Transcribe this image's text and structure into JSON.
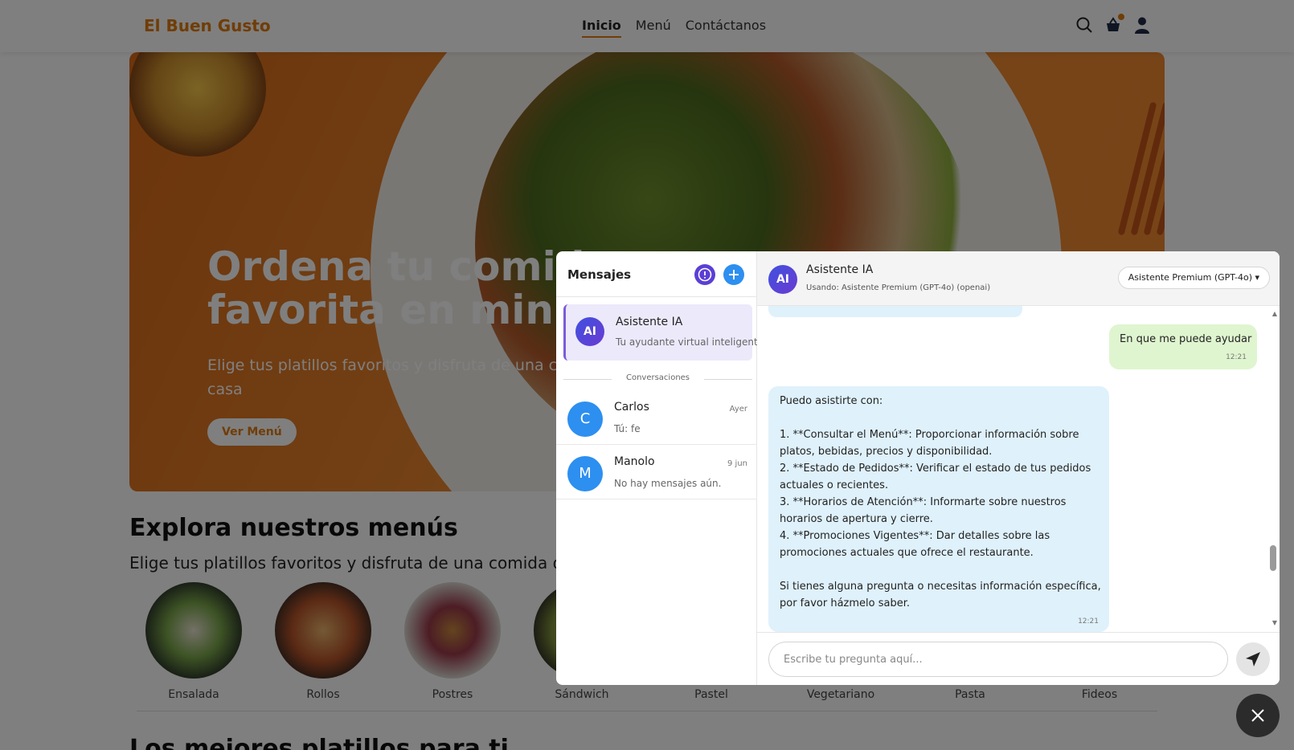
{
  "site": {
    "logo": "El Buen Gusto",
    "nav": [
      "Inicio",
      "Menú",
      "Contáctanos"
    ],
    "icons": [
      "search-icon",
      "basket-icon",
      "user-icon"
    ],
    "accent_color": "#e07a0c"
  },
  "hero": {
    "title": "Ordena tu comida favorita en minutos",
    "subtitle": "Elige tus platillos favoritos y disfruta de una comida deliciosa en casa",
    "button": "Ver Menú"
  },
  "explore": {
    "title": "Explora nuestros menús",
    "subtitle": "Elige tus platillos favoritos y disfruta de una comida deliciosa",
    "categories": [
      "Ensalada",
      "Rollos",
      "Postres",
      "Sándwich",
      "Pastel",
      "Vegetariano",
      "Pasta",
      "Fideos"
    ]
  },
  "best": {
    "title": "Los mejores platillos para ti"
  },
  "chat": {
    "sidebar": {
      "title": "Mensajes",
      "ai_item": {
        "initials": "AI",
        "name": "Asistente IA",
        "subtitle": "Tu ayudante virtual inteligente"
      },
      "divider": "Conversaciones",
      "conversations": [
        {
          "initial": "C",
          "name": "Carlos",
          "when": "Ayer",
          "preview": "Tú: fe"
        },
        {
          "initial": "M",
          "name": "Manolo",
          "when": "9 jun",
          "preview": "No hay mensajes aún."
        }
      ]
    },
    "header": {
      "initials": "AI",
      "name": "Asistente IA",
      "using": "Usando: Asistente Premium (GPT-4o) (openai)",
      "model": "Asistente Premium (GPT-4o) ▾"
    },
    "messages": {
      "user": {
        "text": "En que me puede ayudar",
        "time": "12:21"
      },
      "assistant": {
        "lines": [
          "Puedo asistirte con:",
          "",
          "1. **Consultar el Menú**: Proporcionar información sobre",
          "platos, bebidas, precios y disponibilidad.",
          "2. **Estado de Pedidos**: Verificar el estado de tus pedidos",
          "actuales o recientes.",
          "3. **Horarios de Atención**: Informarte sobre nuestros",
          "horarios de apertura y cierre.",
          "4. **Promociones Vigentes**: Dar detalles sobre las",
          "promociones actuales que ofrece el restaurante.",
          "",
          "Si tienes alguna pregunta o necesitas información específica,",
          "por favor házmelo saber."
        ],
        "time": "12:21"
      }
    },
    "composer": {
      "placeholder": "Escribe tu pregunta aquí..."
    }
  }
}
